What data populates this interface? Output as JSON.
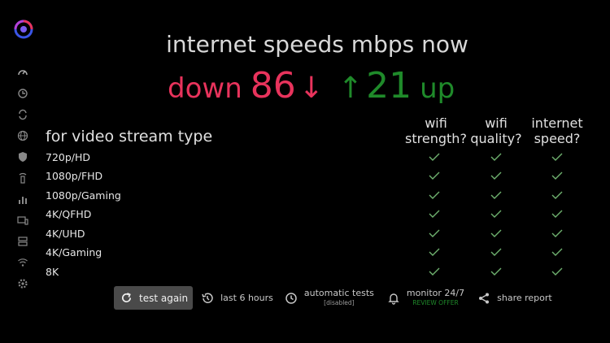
{
  "headline": "internet speeds mbps now",
  "download": {
    "word": "down",
    "value": "86",
    "arrow": "↓"
  },
  "upload": {
    "word": "up",
    "value": "21",
    "arrow": "↑"
  },
  "table": {
    "sub_heading": "for video stream type",
    "columns": [
      {
        "line1": "wifi",
        "line2": "strength?"
      },
      {
        "line1": "wifi",
        "line2": "quality?"
      },
      {
        "line1": "internet",
        "line2": "speed?"
      }
    ],
    "rows": [
      {
        "label": "720p/HD"
      },
      {
        "label": "1080p/FHD"
      },
      {
        "label": "1080p/Gaming"
      },
      {
        "label": "4K/QFHD"
      },
      {
        "label": "4K/UHD"
      },
      {
        "label": "4K/Gaming"
      },
      {
        "label": "8K"
      }
    ]
  },
  "toolbar": {
    "test_again": "test again",
    "last_hours": "last 6 hours",
    "automatic_tests": "automatic tests",
    "automatic_tests_status": "[disabled]",
    "monitor": "monitor 24/7",
    "monitor_offer": "REVIEW OFFER",
    "share": "share report"
  },
  "colors": {
    "down": "#e8335c",
    "up": "#1f8a2a",
    "check": "#6fb26f",
    "button_bg": "#4a4a4a"
  },
  "sidebar_icons": [
    "speedometer-icon",
    "history-icon",
    "sync-icon",
    "globe-icon",
    "shield-icon",
    "router-icon",
    "bar-chart-icon",
    "devices-icon",
    "server-icon",
    "wifi-icon",
    "settings-icon"
  ]
}
